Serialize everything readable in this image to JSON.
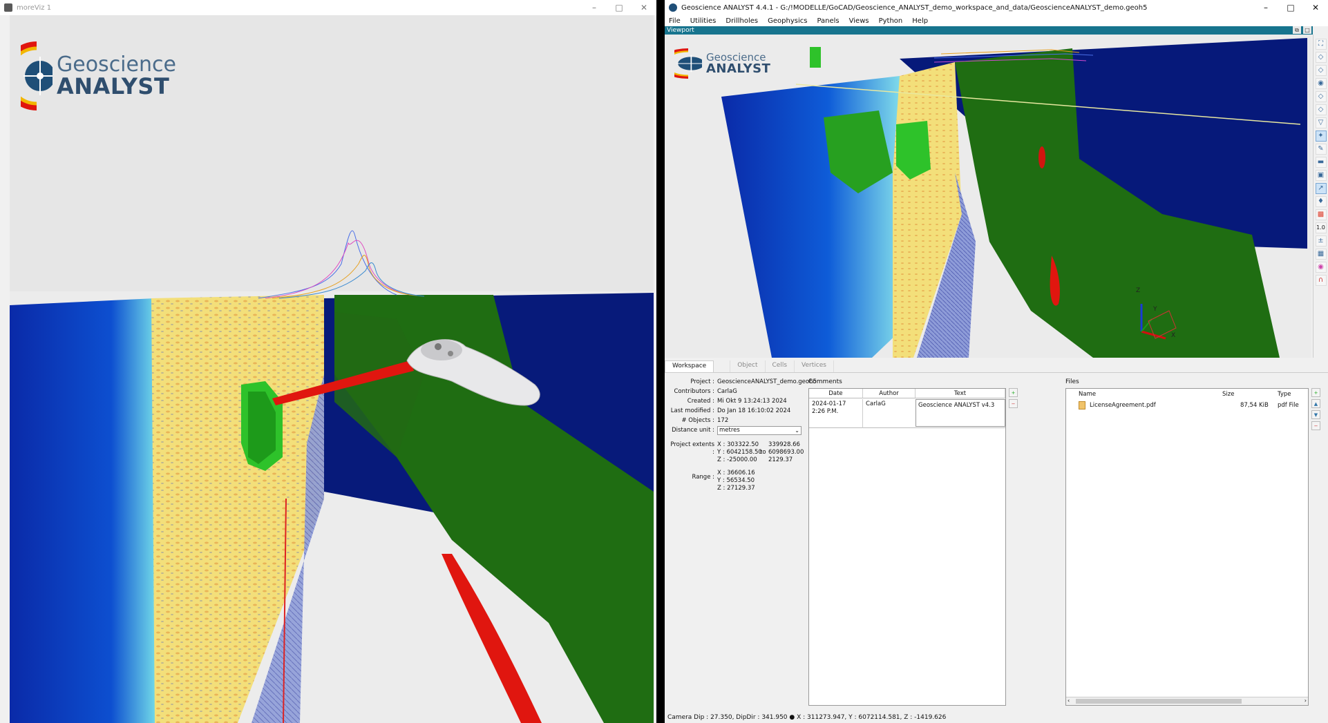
{
  "left_window": {
    "title": "moreViz 1",
    "logo": {
      "line1": "Geoscience",
      "line2": "ANALYST"
    }
  },
  "right_window": {
    "title": "Geoscience ANALYST 4.4.1 - G:/!MODELLE/GoCAD/Geoscience_ANALYST_demo_workspace_and_data/GeoscienceANALYST_demo.geoh5",
    "menu": [
      "File",
      "Utilities",
      "Drillholes",
      "Geophysics",
      "Panels",
      "Views",
      "Python",
      "Help"
    ],
    "viewport_label": "Viewport",
    "logo": {
      "line1": "Geoscience",
      "line2": "ANALYST"
    },
    "axes": {
      "z": "Z",
      "y": "Y",
      "x": "X"
    },
    "toolbar_value": "1.0",
    "tabs": [
      "Workspace",
      "Object",
      "Cells",
      "Vertices"
    ],
    "workspace": {
      "project_label": "Project :",
      "project": "GeoscienceANALYST_demo.geoh5",
      "contributors_label": "Contributors :",
      "contributors": "CarlaG",
      "created_label": "Created :",
      "created": "Mi Okt 9 13:24:13 2024",
      "modified_label": "Last modified :",
      "modified": "Do Jan 18 16:10:02 2024",
      "objects_label": "# Objects :",
      "objects": "172",
      "distance_label": "Distance unit :",
      "distance": "metres",
      "extents_label": "Project extents :",
      "extents_min": [
        "X : 303322.50",
        "Y : 6042158.50",
        "Z : -25000.00"
      ],
      "extents_to": "to",
      "extents_max": [
        "339928.66",
        "6098693.00",
        "2129.37"
      ],
      "range_label": "Range :",
      "range": [
        "X : 36606.16",
        "Y : 56534.50",
        "Z : 27129.37"
      ]
    },
    "comments": {
      "label": "Comments",
      "headers": [
        "Date",
        "Author",
        "Text"
      ],
      "row": {
        "date": "2024-01-17 2:26 P.M.",
        "author": "CarlaG",
        "text": "Geoscience ANALYST v4.3"
      }
    },
    "files": {
      "label": "Files",
      "headers": [
        "Name",
        "Size",
        "Type"
      ],
      "row": {
        "name": "LicenseAgreement.pdf",
        "size": "87,54 KiB",
        "type": "pdf File"
      }
    },
    "status": "Camera Dip : 27.350, DipDir : 341.950  ●  X : 311273.947, Y : 6072114.581, Z : -1419.626"
  },
  "colors": {
    "seismic_yellow": "#f3df7a",
    "model_blue": "#0a2a9a",
    "surface_green": "#1e6e12",
    "accent_red": "#e0160f",
    "viewport_header": "#17748e"
  }
}
